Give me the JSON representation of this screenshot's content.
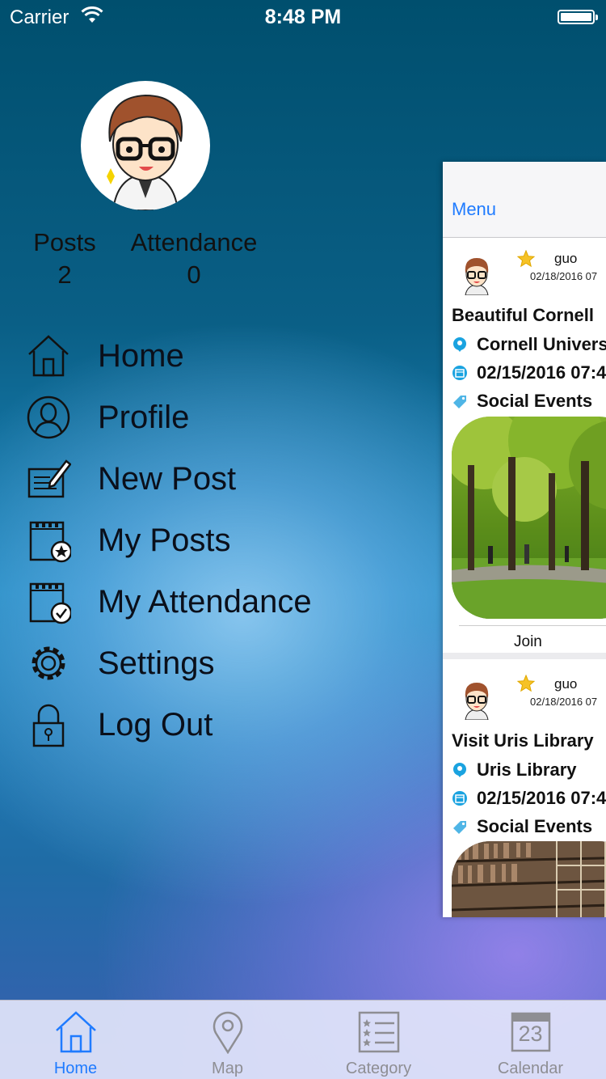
{
  "status_bar": {
    "carrier": "Carrier",
    "time": "8:48 PM"
  },
  "profile": {
    "posts_label": "Posts",
    "posts_count": "2",
    "attendance_label": "Attendance",
    "attendance_count": "0"
  },
  "side_menu": {
    "items": [
      {
        "label": "Home",
        "icon": "home-icon"
      },
      {
        "label": "Profile",
        "icon": "profile-icon"
      },
      {
        "label": "New Post",
        "icon": "new-post-icon"
      },
      {
        "label": "My Posts",
        "icon": "my-posts-icon"
      },
      {
        "label": "My Attendance",
        "icon": "my-attendance-icon"
      },
      {
        "label": "Settings",
        "icon": "gear-icon"
      },
      {
        "label": "Log Out",
        "icon": "lock-icon"
      }
    ]
  },
  "feed_panel": {
    "nav_button": "Menu",
    "posts": [
      {
        "user": "guo",
        "posted": "02/18/2016 07",
        "title": "Beautiful Cornell",
        "location": "Cornell University",
        "event_date": "02/15/2016 07:4",
        "category": "Social Events",
        "action": "Join"
      },
      {
        "user": "guo",
        "posted": "02/18/2016 07",
        "title": "Visit Uris Library",
        "location": "Uris Library",
        "event_date": "02/15/2016 07:4",
        "category": "Social Events"
      }
    ]
  },
  "tab_bar": {
    "tabs": [
      {
        "label": "Home",
        "active": true,
        "icon": "home-icon"
      },
      {
        "label": "Map",
        "active": false,
        "icon": "map-pin-icon"
      },
      {
        "label": "Category",
        "active": false,
        "icon": "list-icon"
      },
      {
        "label": "Calendar",
        "active": false,
        "icon": "calendar-icon",
        "badge": "23"
      }
    ]
  },
  "colors": {
    "accent": "#1f7bff",
    "tab_inactive": "#8e8e93",
    "location_icon": "#1aa3e0"
  }
}
